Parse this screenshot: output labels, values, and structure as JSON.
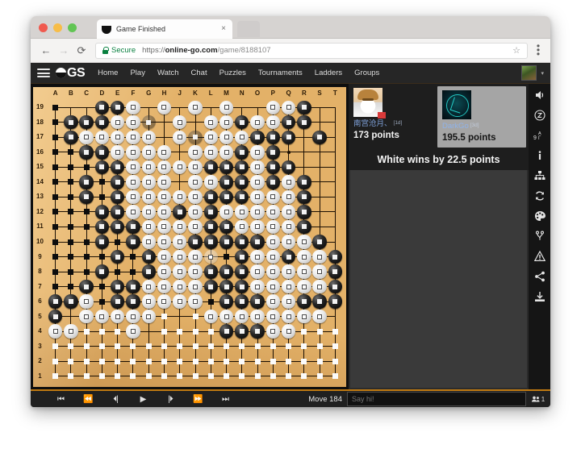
{
  "browser": {
    "tab_title": "Game Finished",
    "tab_close": "×",
    "back_icon": "←",
    "forward_icon": "→",
    "reload_icon": "⟳",
    "secure_label": "Secure",
    "url_scheme": "https://",
    "url_host": "online-go.com",
    "url_path": "/game/8188107",
    "star_icon": "☆",
    "profile_icon": "○"
  },
  "ogs_nav": {
    "logo_text": "GS",
    "links": [
      {
        "label": "Home"
      },
      {
        "label": "Play"
      },
      {
        "label": "Watch"
      },
      {
        "label": "Chat"
      },
      {
        "label": "Puzzles"
      },
      {
        "label": "Tournaments"
      },
      {
        "label": "Ladders"
      },
      {
        "label": "Groups"
      }
    ],
    "caret": "▾"
  },
  "board": {
    "size": 19,
    "col_labels": [
      "A",
      "B",
      "C",
      "D",
      "E",
      "F",
      "G",
      "H",
      "J",
      "K",
      "L",
      "M",
      "N",
      "O",
      "P",
      "Q",
      "R",
      "S",
      "T"
    ],
    "row_labels": [
      "19",
      "18",
      "17",
      "16",
      "15",
      "14",
      "13",
      "12",
      "11",
      "10",
      "9",
      "8",
      "7",
      "6",
      "5",
      "4",
      "3",
      "2",
      "1"
    ],
    "board_color": "#e3b168",
    "stones": [
      "...bbw.w.w.w..wwb..",
      ".bbbwwx.w.wwbwwbb..",
      ".bwwwww.wxwwwbbb.b.",
      "..bbwwww.wwwbwb....",
      "...bbwwwwwbbbwbb...",
      "..b.bwww.wwbbwbwb..",
      "..b.bwwwwwbbbwwwb..",
      "...bbwwwbwbwwwwwb..",
      "...bbbwwwwbbwwwwb..",
      "...b.bwwwbbbbbwwwb.",
      "....b.bwwww.bwwbwwb",
      "...b..bwwwbbbwwwwwb",
      "..b.bbwwwwbbbwwwwwb",
      "bbw.bbwwww.bbbwwbbb",
      "b.wwwww...wwwwwwww.",
      "ww...w.....bbbww...",
      "...................",
      "...................",
      "..................."
    ],
    "territory": [
      "b..................",
      "b..................",
      "b..................",
      "bb.....b...........",
      "bbb................",
      "bb.b...............",
      "bb.b.......b.......",
      "bbb........b.......",
      "bbb.....b..b.......",
      "bbb.b.....b........",
      "bbbb.b.....b.......",
      "bbb.bb.............",
      "bb.b...............",
      "...b......b........",
      ".....www.w.........",
      "..wwww.wwwww....www",
      "wwwwwwwwwwwwwwwwwww",
      "wwwwwwwwwwwwwwwwwww",
      "wwwwwwwwwwwwwwwwwww"
    ],
    "dead_stones": [
      {
        "col": 6,
        "row": 1
      },
      {
        "col": 9,
        "row": 2
      },
      {
        "col": 3,
        "row": 13
      },
      {
        "col": 10,
        "row": 10
      }
    ]
  },
  "players": {
    "black": {
      "name": "南宫沧月、",
      "rank": "[1d]",
      "points": "173 points",
      "avatar": "anime-girl-avatar"
    },
    "white": {
      "name": "DarkGo",
      "rank": "[3d]",
      "points": "195.5 points",
      "avatar": "darkgo-logo-avatar"
    }
  },
  "result": "White wins by 22.5 points",
  "rail_icons": [
    {
      "name": "sound-icon",
      "glyph": "volume"
    },
    {
      "name": "clock-icon",
      "glyph": "clock"
    },
    {
      "name": "coordinates-icon",
      "glyph": "coords"
    },
    {
      "name": "info-icon",
      "glyph": "info"
    },
    {
      "name": "game-tree-icon",
      "glyph": "tree"
    },
    {
      "name": "refresh-icon",
      "glyph": "refresh"
    },
    {
      "name": "themes-icon",
      "glyph": "palette"
    },
    {
      "name": "variation-icon",
      "glyph": "branch"
    },
    {
      "name": "report-icon",
      "glyph": "warning"
    },
    {
      "name": "share-icon",
      "glyph": "share"
    },
    {
      "name": "download-icon",
      "glyph": "download"
    }
  ],
  "controls": {
    "buttons": [
      {
        "name": "first-move-button",
        "glyph": "⏮"
      },
      {
        "name": "fast-back-button",
        "glyph": "⏪"
      },
      {
        "name": "previous-move-button",
        "glyph": "⏴|"
      },
      {
        "name": "play-button",
        "glyph": "▶"
      },
      {
        "name": "next-move-button",
        "glyph": "|⏵"
      },
      {
        "name": "fast-forward-button",
        "glyph": "⏩"
      },
      {
        "name": "last-move-button",
        "glyph": "⏭"
      }
    ],
    "move_label": "Move 184",
    "chat_placeholder": "Say hi!",
    "chat_value": "",
    "viewer_count": "1"
  }
}
